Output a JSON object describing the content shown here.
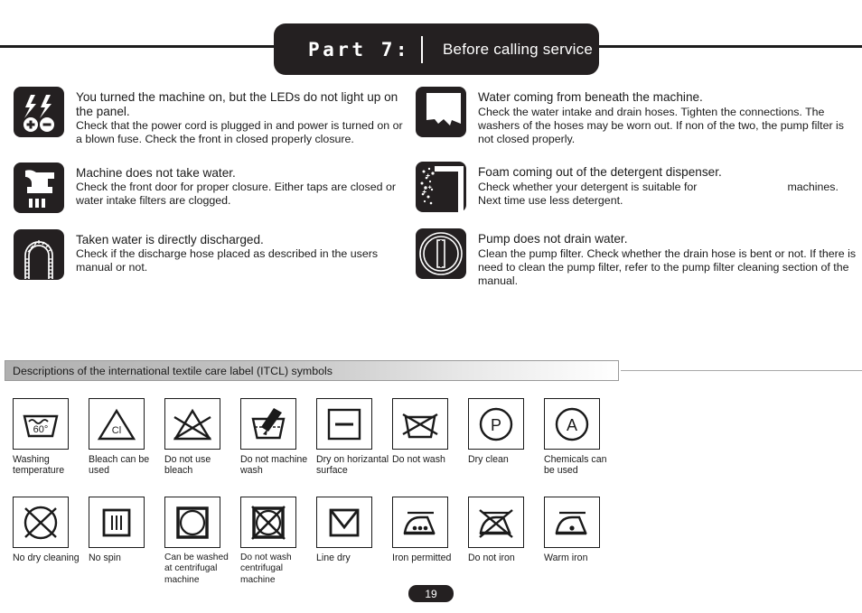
{
  "header": {
    "part_label": "Part 7:",
    "title": "Before calling service"
  },
  "troubleshooting": {
    "left": [
      {
        "icon": "power-led-icon",
        "head": "You turned the machine on, but the LEDs do not light up on the panel.",
        "body": "Check that the power cord is plugged in and power is turned on  or a blown fuse. Check the front in closed properly closure."
      },
      {
        "icon": "tap-water-icon",
        "head": "Machine does not take water.",
        "body": "Check the front door for proper closure. Either taps are closed or water intake filters are clogged."
      },
      {
        "icon": "discharge-hose-icon",
        "head": "Taken water is directly discharged.",
        "body": "Check if the discharge hose placed as described in the users manual or not."
      }
    ],
    "right": [
      {
        "icon": "water-leak-icon",
        "head": "Water coming from beneath the machine.",
        "body": "Check the water intake and drain hoses. Tighten the connections. The washers of the hoses may be worn out. If non of the two, the pump filter is not closed properly."
      },
      {
        "icon": "foam-dispenser-icon",
        "head": "Foam coming out of the detergent dispenser.",
        "body_part1": "Check whether your detergent is suitable for",
        "body_part2": "machines.",
        "body_part3": "Next time use less detergent."
      },
      {
        "icon": "pump-filter-icon",
        "head": "Pump does not drain water.",
        "body": "Clean the pump filter. Check whether the drain hose is bent or not. If there is need to clean the pump filter, refer to the pump filter cleaning section of the manual."
      }
    ]
  },
  "itcl": {
    "bar_title": "Descriptions of the international textile care label (ITCL) symbols",
    "wash_temperature": "60°",
    "bleach_letter": "Cl",
    "dryclean_letter": "P",
    "chemicals_letter": "A",
    "row1": [
      {
        "icon": "washtub-temperature-icon",
        "caption": "Washing temperature"
      },
      {
        "icon": "bleach-triangle-icon",
        "caption": "Bleach can be used"
      },
      {
        "icon": "no-bleach-icon",
        "caption": "Do not use bleach"
      },
      {
        "icon": "hand-wash-icon",
        "caption": "Do not machine wash"
      },
      {
        "icon": "dry-flat-icon",
        "caption": "Dry on horizantal surface"
      },
      {
        "icon": "do-not-wash-icon",
        "caption": "Do not wash"
      },
      {
        "icon": "dry-clean-icon",
        "caption": "Dry clean"
      },
      {
        "icon": "chemicals-allowed-icon",
        "caption": "Chemicals can be used"
      }
    ],
    "row2": [
      {
        "icon": "no-dry-cleaning-icon",
        "caption": "No dry cleaning"
      },
      {
        "icon": "no-spin-icon",
        "caption": "No spin"
      },
      {
        "icon": "centrifugal-wash-icon",
        "caption": "Can be washed at centrifugal machine"
      },
      {
        "icon": "no-centrifugal-wash-icon",
        "caption": "Do not wash centrifugal machine"
      },
      {
        "icon": "line-dry-icon",
        "caption": "Line dry"
      },
      {
        "icon": "iron-permitted-icon",
        "caption": "Iron permitted"
      },
      {
        "icon": "do-not-iron-icon",
        "caption": "Do not iron"
      },
      {
        "icon": "warm-iron-icon",
        "caption": "Warm iron"
      }
    ]
  },
  "footer": {
    "page_number": "19"
  },
  "colors": {
    "ink": "#1a1a1a",
    "badge": "#242021"
  }
}
